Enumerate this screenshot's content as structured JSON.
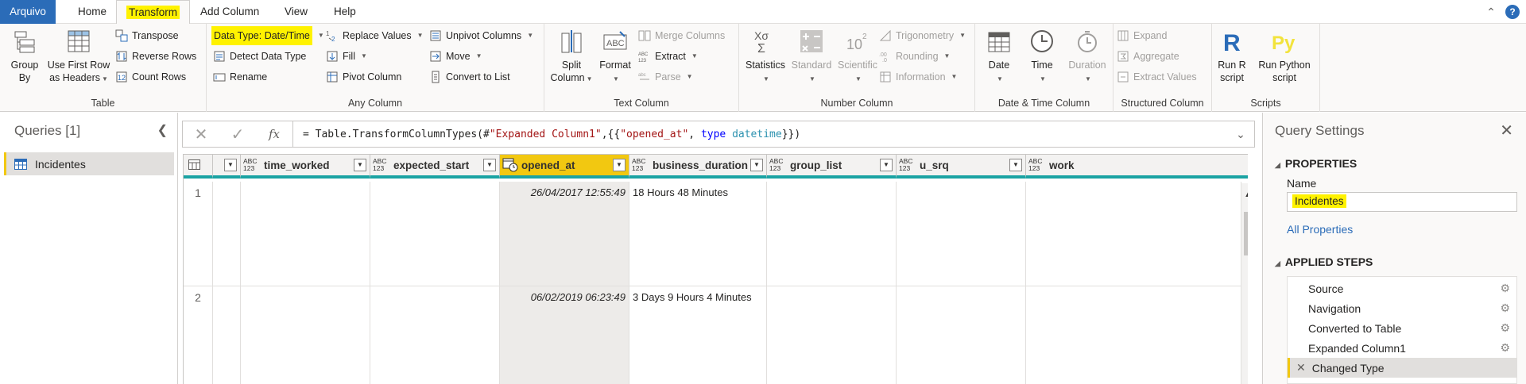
{
  "tabs": {
    "file": "Arquivo",
    "home": "Home",
    "transform": "Transform",
    "add_column": "Add Column",
    "view": "View",
    "help": "Help"
  },
  "ribbon": {
    "table": {
      "group_by_1": "Group",
      "group_by_2": "By",
      "first_row_1": "Use First Row",
      "first_row_2": "as Headers",
      "transpose": "Transpose",
      "reverse_rows": "Reverse Rows",
      "count_rows": "Count Rows",
      "name": "Table"
    },
    "any_column": {
      "data_type": "Data Type: Date/Time",
      "detect": "Detect Data Type",
      "rename": "Rename",
      "replace_values": "Replace Values",
      "fill": "Fill",
      "pivot": "Pivot Column",
      "unpivot": "Unpivot Columns",
      "move": "Move",
      "convert_list": "Convert to List",
      "name": "Any Column"
    },
    "text_column": {
      "split_1": "Split",
      "split_2": "Column",
      "format": "Format",
      "merge": "Merge Columns",
      "extract": "Extract",
      "parse": "Parse",
      "name": "Text Column"
    },
    "number_column": {
      "statistics": "Statistics",
      "standard": "Standard",
      "scientific": "Scientific",
      "trig": "Trigonometry",
      "rounding": "Rounding",
      "information": "Information",
      "name": "Number Column"
    },
    "datetime_column": {
      "date": "Date",
      "time": "Time",
      "duration": "Duration",
      "name": "Date & Time Column"
    },
    "structured_column": {
      "expand": "Expand",
      "aggregate": "Aggregate",
      "extract_values": "Extract Values",
      "name": "Structured Column"
    },
    "scripts": {
      "run_r_1": "Run R",
      "run_r_2": "script",
      "run_py_1": "Run Python",
      "run_py_2": "script",
      "name": "Scripts"
    }
  },
  "queries": {
    "title": "Queries [1]",
    "items": [
      "Incidentes"
    ]
  },
  "formula": {
    "prefix": "= Table.TransformColumnTypes(#",
    "str1": "\"Expanded Column1\"",
    "mid": ",{{",
    "str2": "\"opened_at\"",
    "comma": ", ",
    "kw": "type",
    "space": " ",
    "typ": "datetime",
    "suffix": "}})"
  },
  "grid": {
    "type_abc": "ABC",
    "type_123": "123",
    "columns": [
      "time_worked",
      "expected_start",
      "opened_at",
      "business_duration",
      "group_list",
      "u_srq",
      "work"
    ],
    "rows": [
      {
        "num": "1",
        "opened_at": "26/04/2017 12:55:49",
        "business_duration": "18 Hours 48 Minutes"
      },
      {
        "num": "2",
        "opened_at": "06/02/2019 06:23:49",
        "business_duration": "3 Days 9 Hours 4 Minutes"
      }
    ]
  },
  "settings": {
    "title": "Query Settings",
    "properties": "PROPERTIES",
    "name_label": "Name",
    "name_value": "Incidentes",
    "all_properties": "All Properties",
    "applied_steps": "APPLIED STEPS",
    "steps": [
      "Source",
      "Navigation",
      "Converted to Table",
      "Expanded Column1",
      "Changed Type"
    ]
  },
  "colors": {
    "accent_yellow": "#f2c811",
    "highlight": "#fff200",
    "file_tab": "#2b6cb8",
    "column_quality": "#1aa3a3"
  }
}
